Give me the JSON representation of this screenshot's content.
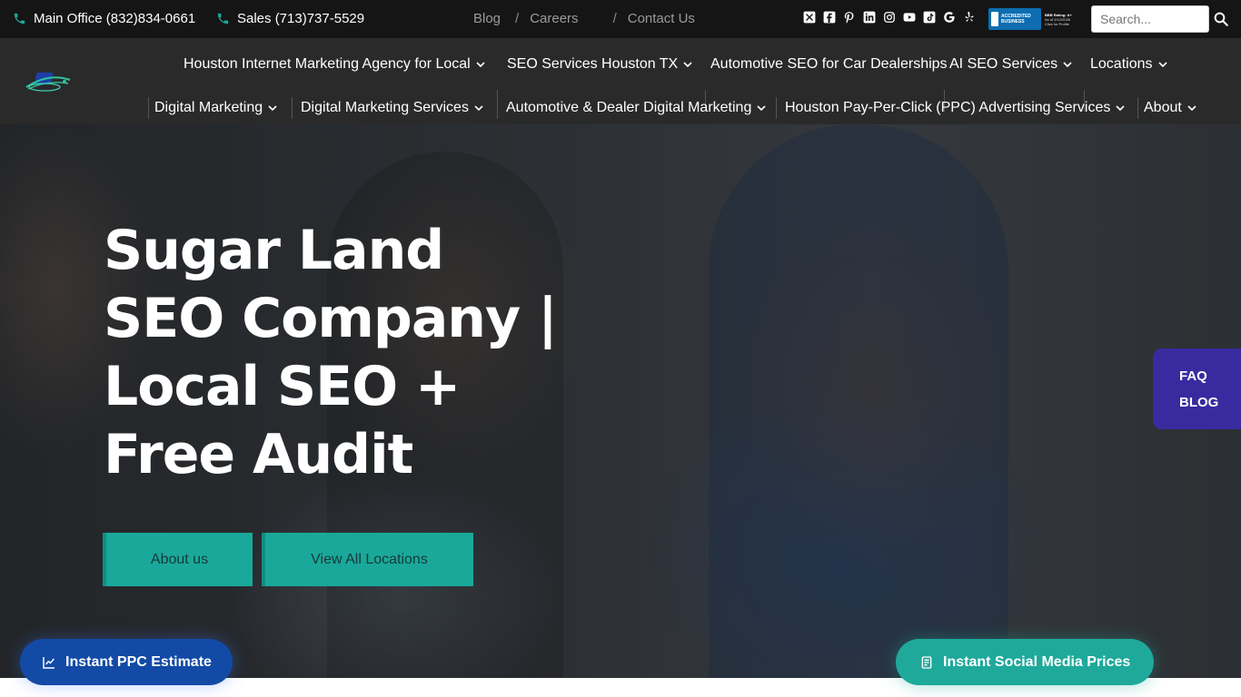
{
  "topbar": {
    "main_office": "Main Office (832)834-0661",
    "sales": "Sales (713)737-5529",
    "links": {
      "blog": "Blog",
      "careers": "Careers",
      "contact": "Contact Us"
    },
    "sep": "/",
    "search_placeholder": "Search...",
    "bbb": {
      "line1": "ACCREDITED",
      "line2": "BUSINESS",
      "rating": "BBB Rating: A+",
      "as_of": "As of 2/12/2026",
      "click": "Click for Profile"
    }
  },
  "nav": {
    "row1": [
      "Houston Internet Marketing Agency for Local",
      "SEO Services Houston TX",
      "Automotive SEO for Car Dealerships",
      "AI SEO Services",
      "Locations"
    ],
    "row2": [
      "Digital Marketing",
      "Digital Marketing Services",
      "Automotive & Dealer Digital Marketing",
      "Houston Pay-Per-Click (PPC) Advertising Services",
      "About"
    ]
  },
  "hero": {
    "title": "Sugar Land SEO Company | Local SEO + Free Audit",
    "btn_about": "About us",
    "btn_locations": "View All Locations"
  },
  "side_panel": {
    "faq": "FAQ",
    "blog": "BLOG"
  },
  "floating": {
    "ppc": "Instant PPC Estimate",
    "social": "Instant Social Media Prices"
  },
  "colors": {
    "teal": "#1aa89a",
    "purple": "#3a2aa0",
    "blue": "#124aa6",
    "topbar": "#151515",
    "nav": "#2a2a2a"
  }
}
